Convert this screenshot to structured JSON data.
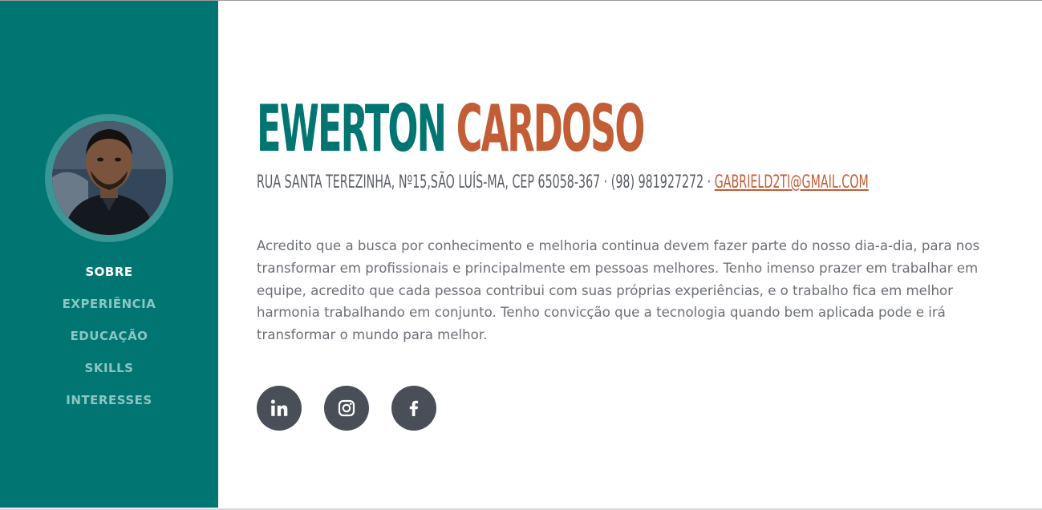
{
  "profile": {
    "first_name": "EWERTON",
    "last_name": "CARDOSO",
    "address": "Rua Santa Terezinha, Nº15,São Luís-MA, CEP 65058-367",
    "separator": " · ",
    "phone": "(98) 981927272",
    "email": "gabrield2ti@gmail.com",
    "bio": "Acredito que a busca por conhecimento e melhoria continua devem fazer parte do nosso dia-a-dia, para nos transformar em profissionais e principalmente em pessoas melhores. Tenho imenso prazer em trabalhar em equipe, acredito que cada pessoa contribui com suas próprias experiências, e o trabalho fica em melhor harmonia trabalhando em conjunto. Tenho convicção que a tecnologia quando bem aplicada pode e irá transformar o mundo para melhor."
  },
  "nav": {
    "items": [
      {
        "label": "SOBRE",
        "active": true
      },
      {
        "label": "EXPERIÊNCIA"
      },
      {
        "label": "EDUCAÇÃO"
      },
      {
        "label": "SKILLS"
      },
      {
        "label": "INTERESSES"
      }
    ]
  },
  "socials": [
    {
      "icon": "linkedin-icon"
    },
    {
      "icon": "instagram-icon"
    },
    {
      "icon": "facebook-icon"
    }
  ],
  "colors": {
    "sidebar": "#007571",
    "accent": "#c25d36",
    "nav_inactive": "#8cc6c3",
    "text": "#6c6f78",
    "social_bg": "#494e58"
  }
}
